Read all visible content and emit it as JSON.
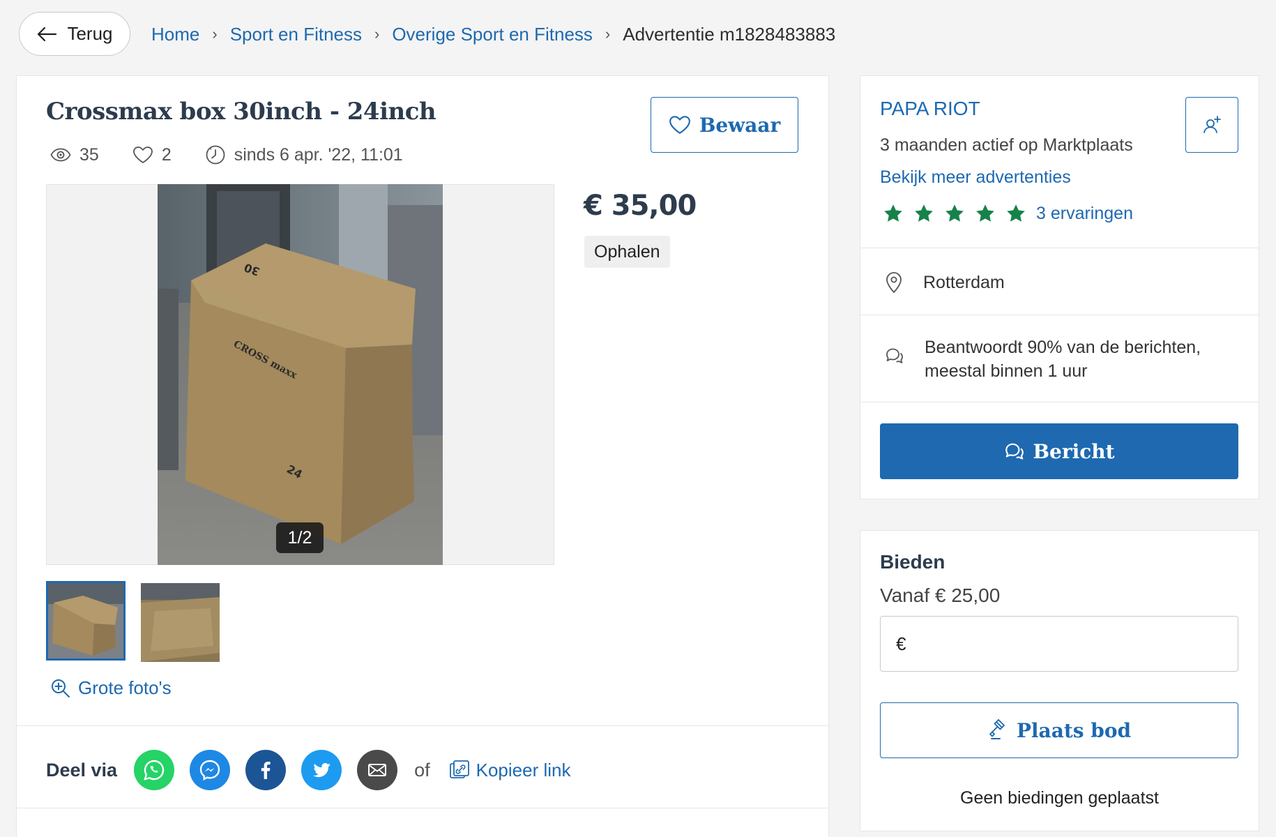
{
  "nav": {
    "back_label": "Terug",
    "breadcrumb": [
      "Home",
      "Sport en Fitness",
      "Overige Sport en Fitness"
    ],
    "breadcrumb_current": "Advertentie m1828483883"
  },
  "listing": {
    "title": "Crossmax box 30inch - 24inch",
    "views": "35",
    "favorites": "2",
    "since": "sinds 6 apr. '22, 11:01",
    "save_label": "Bewaar",
    "photo_counter": "1/2",
    "big_photos_label": "Grote foto's",
    "price": "€ 35,00",
    "delivery": "Ophalen",
    "box_markings": [
      "30",
      "CROSS maxx",
      "24"
    ]
  },
  "share": {
    "label": "Deel via",
    "icons": [
      "whatsapp-icon",
      "messenger-icon",
      "facebook-icon",
      "twitter-icon",
      "email-icon"
    ],
    "or": "of",
    "copy_label": "Kopieer link"
  },
  "seller": {
    "name": "PAPA RIOT",
    "active": "3 maanden actief op Marktplaats",
    "more_ads": "Bekijk meer advertenties",
    "rating": 5,
    "reviews": "3 ervaringen",
    "location": "Rotterdam",
    "response_line1": "Beantwoordt 90% van de berichten,",
    "response_line2": "meestal binnen 1 uur",
    "message_label": "Bericht"
  },
  "bid": {
    "title": "Bieden",
    "from": "Vanaf € 25,00",
    "currency": "€",
    "button_label": "Plaats bod",
    "status": "Geen biedingen geplaatst"
  },
  "colors": {
    "brand_blue": "#1e69b0",
    "star_green": "#16824a",
    "whatsapp": "#25d366",
    "messenger": "#1e88e5",
    "facebook": "#1c5595",
    "twitter": "#1d9bf0",
    "email": "#4a4a4a"
  }
}
